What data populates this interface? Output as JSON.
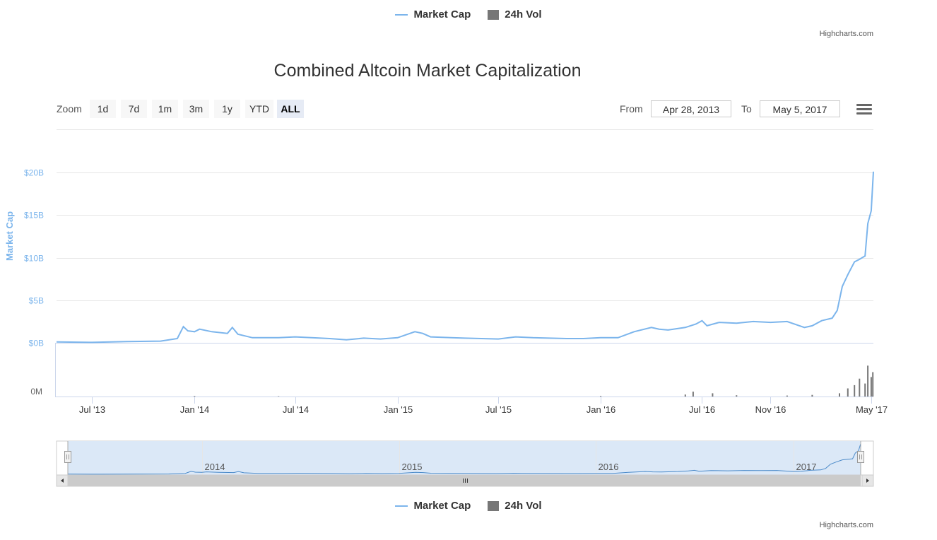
{
  "legend_top": {
    "market_cap": "Market Cap",
    "volume": "24h Vol"
  },
  "legend_bottom": {
    "market_cap": "Market Cap",
    "volume": "24h Vol"
  },
  "credits": "Highcharts.com",
  "credits_bottom": "Highcharts.com",
  "zoom": {
    "label": "Zoom",
    "buttons": [
      "1d",
      "7d",
      "1m",
      "3m",
      "1y",
      "YTD",
      "ALL"
    ],
    "selected": "ALL"
  },
  "range": {
    "from_label": "From",
    "from_value": "Apr 28, 2013",
    "to_label": "To",
    "to_value": "May 5, 2017"
  },
  "colors": {
    "market_cap": "#7cb5ec",
    "volume": "#777777",
    "navigator_mask": "#dbe8f7"
  },
  "chart_data": {
    "type": "line",
    "title": "Combined Altcoin Market Capitalization",
    "ylabel": "Market Cap",
    "y_ticks": [
      "$0B",
      "$5B",
      "$10B",
      "$15B",
      "$20B"
    ],
    "ylim": [
      0,
      20
    ],
    "volume_axis_label": "0M",
    "x_ticks": [
      "Jul '13",
      "Jan '14",
      "Jul '14",
      "Jan '15",
      "Jul '15",
      "Jan '16",
      "Jul '16",
      "Nov '16",
      "May '17"
    ],
    "x_range": [
      "2013-04-28",
      "2017-05-05"
    ],
    "navigator_labels": [
      "2014",
      "2015",
      "2016",
      "2017"
    ],
    "grid": true,
    "legend_position": "top",
    "series": [
      {
        "name": "Market Cap",
        "unit": "billion USD",
        "points": [
          [
            "2013-04-28",
            0.1
          ],
          [
            "2013-07-01",
            0.05
          ],
          [
            "2013-09-01",
            0.15
          ],
          [
            "2013-11-01",
            0.2
          ],
          [
            "2013-12-01",
            0.5
          ],
          [
            "2013-12-12",
            1.9
          ],
          [
            "2013-12-20",
            1.4
          ],
          [
            "2014-01-01",
            1.3
          ],
          [
            "2014-01-10",
            1.6
          ],
          [
            "2014-02-01",
            1.3
          ],
          [
            "2014-03-01",
            1.1
          ],
          [
            "2014-03-10",
            1.8
          ],
          [
            "2014-03-20",
            1.0
          ],
          [
            "2014-04-15",
            0.6
          ],
          [
            "2014-06-01",
            0.6
          ],
          [
            "2014-07-01",
            0.7
          ],
          [
            "2014-09-01",
            0.5
          ],
          [
            "2014-10-01",
            0.35
          ],
          [
            "2014-11-01",
            0.55
          ],
          [
            "2014-12-01",
            0.45
          ],
          [
            "2015-01-01",
            0.6
          ],
          [
            "2015-02-01",
            1.3
          ],
          [
            "2015-02-15",
            1.1
          ],
          [
            "2015-03-01",
            0.7
          ],
          [
            "2015-05-01",
            0.55
          ],
          [
            "2015-07-01",
            0.45
          ],
          [
            "2015-08-01",
            0.7
          ],
          [
            "2015-09-01",
            0.6
          ],
          [
            "2015-11-01",
            0.5
          ],
          [
            "2015-12-01",
            0.5
          ],
          [
            "2016-01-01",
            0.6
          ],
          [
            "2016-02-01",
            0.6
          ],
          [
            "2016-03-01",
            1.3
          ],
          [
            "2016-04-01",
            1.8
          ],
          [
            "2016-04-15",
            1.6
          ],
          [
            "2016-05-01",
            1.5
          ],
          [
            "2016-06-01",
            1.8
          ],
          [
            "2016-06-20",
            2.2
          ],
          [
            "2016-07-01",
            2.6
          ],
          [
            "2016-07-10",
            2.0
          ],
          [
            "2016-08-01",
            2.4
          ],
          [
            "2016-09-01",
            2.3
          ],
          [
            "2016-10-01",
            2.5
          ],
          [
            "2016-11-01",
            2.4
          ],
          [
            "2016-12-01",
            2.5
          ],
          [
            "2017-01-01",
            1.8
          ],
          [
            "2017-01-15",
            2.0
          ],
          [
            "2017-02-01",
            2.6
          ],
          [
            "2017-02-20",
            2.9
          ],
          [
            "2017-03-01",
            3.8
          ],
          [
            "2017-03-10",
            6.6
          ],
          [
            "2017-03-20",
            8.0
          ],
          [
            "2017-04-01",
            9.5
          ],
          [
            "2017-04-10",
            9.8
          ],
          [
            "2017-04-20",
            10.2
          ],
          [
            "2017-04-25",
            14.0
          ],
          [
            "2017-05-01",
            15.5
          ],
          [
            "2017-05-05",
            20.1
          ]
        ]
      },
      {
        "name": "24h Vol",
        "type": "column",
        "unit": "relative",
        "points": [
          [
            "2014-01-01",
            0.02
          ],
          [
            "2014-06-01",
            0.01
          ],
          [
            "2016-01-01",
            0.02
          ],
          [
            "2016-06-01",
            0.06
          ],
          [
            "2016-06-15",
            0.15
          ],
          [
            "2016-07-20",
            0.1
          ],
          [
            "2016-09-01",
            0.04
          ],
          [
            "2016-12-01",
            0.03
          ],
          [
            "2017-01-15",
            0.05
          ],
          [
            "2017-03-05",
            0.1
          ],
          [
            "2017-03-20",
            0.25
          ],
          [
            "2017-04-01",
            0.35
          ],
          [
            "2017-04-10",
            0.55
          ],
          [
            "2017-04-20",
            0.4
          ],
          [
            "2017-04-25",
            0.95
          ],
          [
            "2017-05-01",
            0.6
          ],
          [
            "2017-05-04",
            0.75
          ]
        ]
      }
    ]
  }
}
